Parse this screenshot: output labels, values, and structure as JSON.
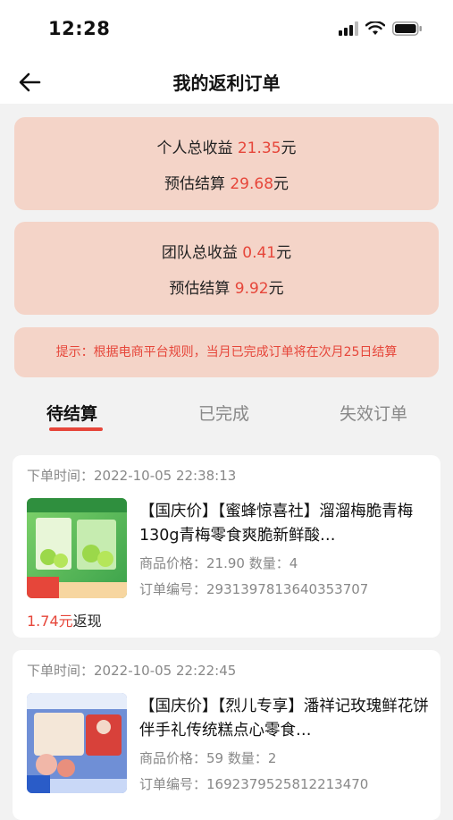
{
  "status_bar": {
    "time": "12:28"
  },
  "header": {
    "title": "我的返利订单"
  },
  "personal": {
    "earnings_label": "个人总收益",
    "earnings_value": "21.35",
    "estimate_label": "预估结算",
    "estimate_value": "29.68",
    "unit": "元"
  },
  "team": {
    "earnings_label": "团队总收益",
    "earnings_value": "0.41",
    "estimate_label": "预估结算",
    "estimate_value": "9.92",
    "unit": "元"
  },
  "notice": "提示：根据电商平台规则，当月已完成订单将在次月25日结算",
  "tabs": [
    {
      "label": "待结算",
      "active": true
    },
    {
      "label": "已完成",
      "active": false
    },
    {
      "label": "失效订单",
      "active": false
    }
  ],
  "orders": [
    {
      "time_label": "下单时间：",
      "time": "2022-10-05 22:38:13",
      "title": "【国庆价】【蜜蜂惊喜社】溜溜梅脆青梅130g青梅零食爽脆新鲜酸…",
      "price_label": "商品价格：",
      "price": "21.90",
      "qty_label": "数量：",
      "qty": "4",
      "order_no_label": "订单编号：",
      "order_no": "2931397813640353707",
      "cashback_value": "1.74",
      "cashback_unit": "元",
      "cashback_label": "返现"
    },
    {
      "time_label": "下单时间：",
      "time": "2022-10-05 22:22:45",
      "title": "【国庆价】【烈儿专享】潘祥记玫瑰鲜花饼伴手礼传统糕点心零食…",
      "price_label": "商品价格：",
      "price": "59",
      "qty_label": "数量：",
      "qty": "2",
      "order_no_label": "订单编号：",
      "order_no": "1692379525812213470"
    }
  ],
  "colors": {
    "accent": "#e6463a",
    "card_bg": "#f4d4c8",
    "page_bg": "#f2f2f2"
  }
}
